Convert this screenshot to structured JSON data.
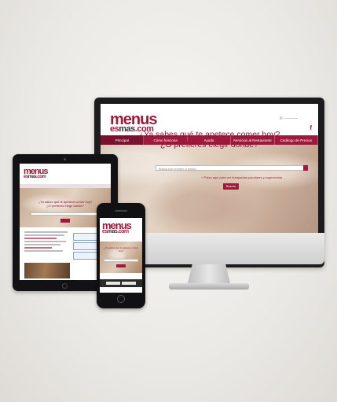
{
  "brand": {
    "name_main": "menus",
    "name_sub_1": "es",
    "name_sub_2": "mas",
    "name_sub_3": ".com",
    "accent": "#9e1a3c"
  },
  "desktop": {
    "facebook_icon": "f",
    "nav": [
      "Principal",
      "Cómo funciona",
      "Ayuda",
      "Servicios al Restaurante",
      "Catálogo de Precios"
    ],
    "hero": {
      "title_line_1": "¿Ya sabes qué te apetece comer hoy?",
      "title_line_2": "¿O prefieres elegir dónde?",
      "search_placeholder": "Busca por nombre o barrio...",
      "link_text": "+ Pulsa aquí para ver búsquedas populares y sugerencias",
      "button": "Buscar"
    }
  },
  "tablet": {
    "hero_line_1": "¿Ya sabes qué te apetece comer hoy?",
    "hero_line_2": "¿O prefieres elegir dónde?"
  },
  "phone": {
    "hero_line_1": "¿Ya sabes qué te apetece comer hoy?"
  }
}
